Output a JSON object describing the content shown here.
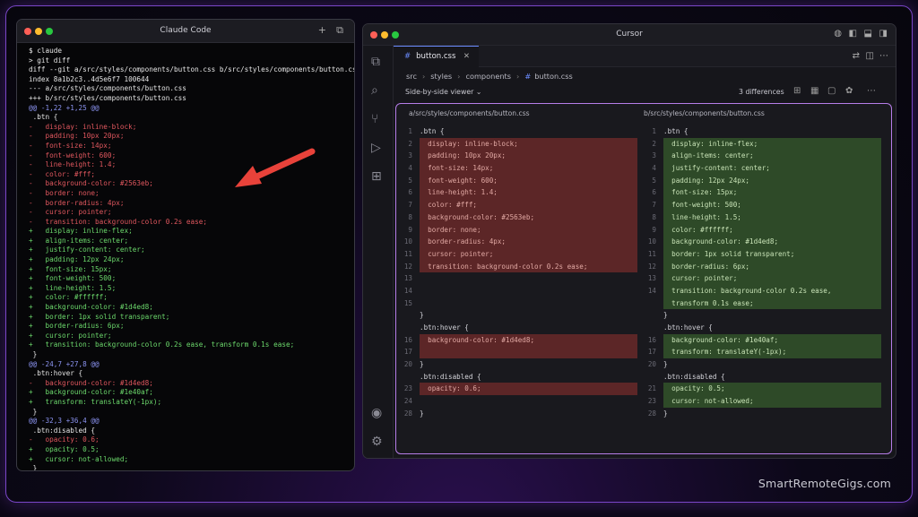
{
  "terminal": {
    "title": "Claude Code",
    "lines": [
      {
        "t": "$ claude",
        "c": "w"
      },
      {
        "t": "> git diff",
        "c": "w"
      },
      {
        "t": "diff --git a/src/styles/components/button.css b/src/styles/components/button.cs",
        "c": "w"
      },
      {
        "t": "index 8a1b2c3..4d5e6f7 100644",
        "c": "w"
      },
      {
        "t": "--- a/src/styles/components/button.css",
        "c": "w"
      },
      {
        "t": "+++ b/src/styles/components/button.css",
        "c": "w"
      },
      {
        "t": "@@ -1,22 +1,25 @@",
        "c": "h"
      },
      {
        "t": " .btn {",
        "c": "w"
      },
      {
        "t": "-   display: inline-block;",
        "c": "r"
      },
      {
        "t": "-   padding: 10px 20px;",
        "c": "r"
      },
      {
        "t": "-   font-size: 14px;",
        "c": "r"
      },
      {
        "t": "-   font-weight: 600;",
        "c": "r"
      },
      {
        "t": "-   line-height: 1.4;",
        "c": "r"
      },
      {
        "t": "-   color: #fff;",
        "c": "r"
      },
      {
        "t": "-   background-color: #2563eb;",
        "c": "r"
      },
      {
        "t": "-   border: none;",
        "c": "r"
      },
      {
        "t": "-   border-radius: 4px;",
        "c": "r"
      },
      {
        "t": "-   cursor: pointer;",
        "c": "r"
      },
      {
        "t": "-   transition: background-color 0.2s ease;",
        "c": "r"
      },
      {
        "t": "+   display: inline-flex;",
        "c": "g"
      },
      {
        "t": "+   align-items: center;",
        "c": "g"
      },
      {
        "t": "+   justify-content: center;",
        "c": "g"
      },
      {
        "t": "+   padding: 12px 24px;",
        "c": "g"
      },
      {
        "t": "+   font-size: 15px;",
        "c": "g"
      },
      {
        "t": "+   font-weight: 500;",
        "c": "g"
      },
      {
        "t": "+   line-height: 1.5;",
        "c": "g"
      },
      {
        "t": "+   color: #ffffff;",
        "c": "g"
      },
      {
        "t": "+   background-color: #1d4ed8;",
        "c": "g"
      },
      {
        "t": "+   border: 1px solid transparent;",
        "c": "g"
      },
      {
        "t": "+   border-radius: 6px;",
        "c": "g"
      },
      {
        "t": "+   cursor: pointer;",
        "c": "g"
      },
      {
        "t": "+   transition: background-color 0.2s ease, transform 0.1s ease;",
        "c": "g"
      },
      {
        "t": " }",
        "c": "w"
      },
      {
        "t": "@@ -24,7 +27,8 @@",
        "c": "h"
      },
      {
        "t": " .btn:hover {",
        "c": "w"
      },
      {
        "t": "-   background-color: #1d4ed8;",
        "c": "r"
      },
      {
        "t": "+   background-color: #1e40af;",
        "c": "g"
      },
      {
        "t": "+   transform: translateY(-1px);",
        "c": "g"
      },
      {
        "t": " }",
        "c": "w"
      },
      {
        "t": "@@ -32,3 +36,4 @@",
        "c": "h"
      },
      {
        "t": " .btn:disabled {",
        "c": "w"
      },
      {
        "t": "-   opacity: 0.6;",
        "c": "r"
      },
      {
        "t": "+   opacity: 0.5;",
        "c": "g"
      },
      {
        "t": "+   cursor: not-allowed;",
        "c": "g"
      },
      {
        "t": " }",
        "c": "w"
      }
    ]
  },
  "cursor": {
    "title": "Cursor",
    "tab_label": "button.css",
    "tab_close": "✕",
    "breadcrumb": [
      "src",
      "styles",
      "components",
      "button.css"
    ],
    "viewer_label": "Side-by-side viewer",
    "differences": "3 differences",
    "left_header": "a/src/styles/components/button.css",
    "right_header": "b/src/styles/components/button.css",
    "left_rows": [
      {
        "n": "1",
        "t": ".btn {",
        "k": "n"
      },
      {
        "n": "2",
        "t": "  display: inline-block;",
        "k": "d"
      },
      {
        "n": "3",
        "t": "  padding: 10px 20px;",
        "k": "d"
      },
      {
        "n": "4",
        "t": "  font-size: 14px;",
        "k": "d"
      },
      {
        "n": "5",
        "t": "  font-weight: 600;",
        "k": "d"
      },
      {
        "n": "6",
        "t": "  line-height: 1.4;",
        "k": "d"
      },
      {
        "n": "7",
        "t": "  color: #fff;",
        "k": "d"
      },
      {
        "n": "8",
        "t": "  background-color: #2563eb;",
        "k": "d"
      },
      {
        "n": "9",
        "t": "  border: none;",
        "k": "d"
      },
      {
        "n": "10",
        "t": "  border-radius: 4px;",
        "k": "d"
      },
      {
        "n": "11",
        "t": "  cursor: pointer;",
        "k": "d"
      },
      {
        "n": "12",
        "t": "  transition: background-color 0.2s ease;",
        "k": "d"
      },
      {
        "n": "13",
        "t": "",
        "k": "n"
      },
      {
        "n": "14",
        "t": "",
        "k": "n"
      },
      {
        "n": "15",
        "t": "",
        "k": "n"
      },
      {
        "n": "",
        "t": "}",
        "k": "n"
      },
      {
        "n": "",
        "t": ".btn:hover {",
        "k": "n"
      },
      {
        "n": "16",
        "t": "  background-color: #1d4ed8;",
        "k": "d"
      },
      {
        "n": "17",
        "t": "",
        "k": "d"
      },
      {
        "n": "20",
        "t": "}",
        "k": "n"
      },
      {
        "n": "",
        "t": ".btn:disabled {",
        "k": "n"
      },
      {
        "n": "23",
        "t": "  opacity: 0.6;",
        "k": "d"
      },
      {
        "n": "24",
        "t": "",
        "k": "n"
      },
      {
        "n": "28",
        "t": "}",
        "k": "n"
      }
    ],
    "right_rows": [
      {
        "n": "1",
        "t": ".btn {",
        "k": "n"
      },
      {
        "n": "2",
        "t": "  display: inline-flex;",
        "k": "a"
      },
      {
        "n": "3",
        "t": "  align-items: center;",
        "k": "a"
      },
      {
        "n": "4",
        "t": "  justify-content: center;",
        "k": "a"
      },
      {
        "n": "5",
        "t": "  padding: 12px 24px;",
        "k": "a"
      },
      {
        "n": "6",
        "t": "  font-size: 15px;",
        "k": "a"
      },
      {
        "n": "7",
        "t": "  font-weight: 500;",
        "k": "a"
      },
      {
        "n": "8",
        "t": "  line-height: 1.5;",
        "k": "a"
      },
      {
        "n": "9",
        "t": "  color: #ffffff;",
        "k": "a"
      },
      {
        "n": "10",
        "t": "  background-color: #1d4ed8;",
        "k": "a"
      },
      {
        "n": "11",
        "t": "  border: 1px solid transparent;",
        "k": "a"
      },
      {
        "n": "12",
        "t": "  border-radius: 6px;",
        "k": "a"
      },
      {
        "n": "13",
        "t": "  cursor: pointer;",
        "k": "a"
      },
      {
        "n": "14",
        "t": "  transition: background-color 0.2s ease,",
        "k": "a"
      },
      {
        "n": "",
        "t": "  transform 0.1s ease;",
        "k": "a"
      },
      {
        "n": "",
        "t": "}",
        "k": "n"
      },
      {
        "n": "",
        "t": ".btn:hover {",
        "k": "n"
      },
      {
        "n": "16",
        "t": "  background-color: #1e40af;",
        "k": "a"
      },
      {
        "n": "17",
        "t": "  transform: translateY(-1px);",
        "k": "a"
      },
      {
        "n": "20",
        "t": "}",
        "k": "n"
      },
      {
        "n": "",
        "t": ".btn:disabled {",
        "k": "n"
      },
      {
        "n": "21",
        "t": "  opacity: 0.5;",
        "k": "a"
      },
      {
        "n": "23",
        "t": "  cursor: not-allowed;",
        "k": "a"
      },
      {
        "n": "28",
        "t": "}",
        "k": "n"
      }
    ]
  },
  "watermark": "SmartRemoteGigs.com",
  "colors": {
    "frame": "#7a46c8",
    "panel_border": "#b67de8",
    "deleted": "#5c2627",
    "added": "#2e4a28",
    "arrow": "#e8423a"
  }
}
